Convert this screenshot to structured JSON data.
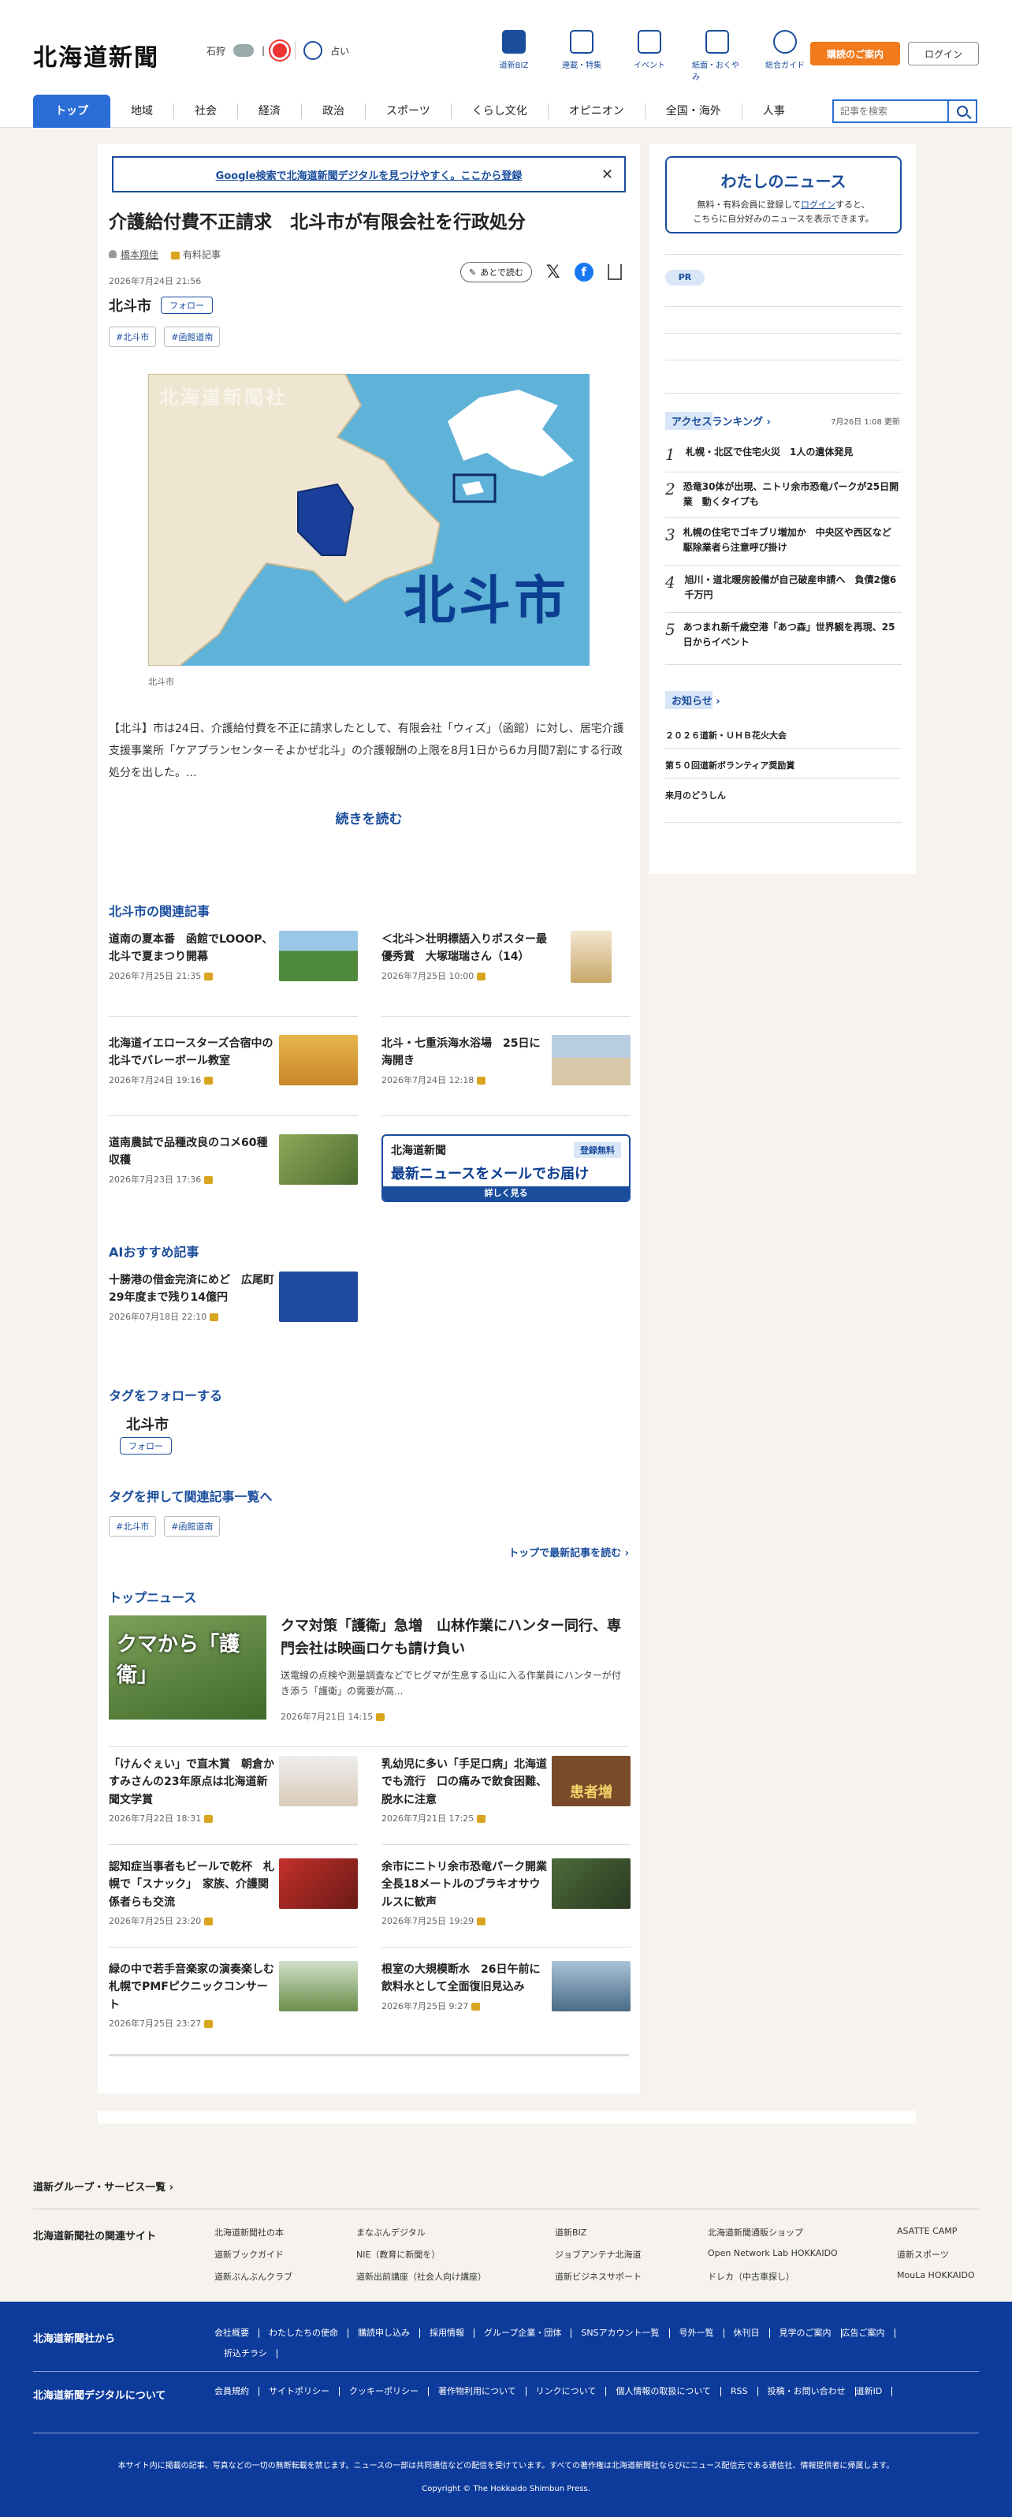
{
  "header": {
    "logo": "北海道新聞",
    "weather_city": "石狩",
    "fortune_label": "占い",
    "nav": [
      "道新BIZ",
      "連載・特集",
      "イベント",
      "紙面・おくやみ",
      "総合ガイド"
    ],
    "subscribe": "購読のご案内",
    "login": "ログイン",
    "search_placeholder": "記事を検索"
  },
  "main_nav": [
    "トップ",
    "地域",
    "社会",
    "経済",
    "政治",
    "スポーツ",
    "くらし文化",
    "オピニオン",
    "全国・海外",
    "人事"
  ],
  "promo": "Google検索で北海道新聞デジタルを見つけやすく。ここから登録",
  "article": {
    "title": "介護給付費不正請求　北斗市が有限会社を行政処分",
    "author": "橋本翔佳",
    "paid_label": "有料記事",
    "date": "2026年7月24日 21:56",
    "later_label": "あとで読む",
    "tag_name": "北斗市",
    "follow": "フォロー",
    "hashtags": [
      "#北斗市",
      "#函館道南"
    ],
    "map_watermark": "北海道新聞社",
    "map_label": "北斗市",
    "map_caption": "北斗市",
    "lead": "【北斗】市は24日、介護給付費を不正に請求したとして、有限会社「ウィズ」（函館）に対し、居宅介護支援事業所「ケアプランセンターそよかぜ北斗」の介護報酬の上限を8月1日から6カ月間7割にする行政処分を出した。...",
    "read_more": "続きを読む"
  },
  "related": {
    "heading": "北斗市の関連記事",
    "items": [
      {
        "title": "道南の夏本番　函館でLOOOP、北斗で夏まつり開幕",
        "date": "2026年7月25日 21:35"
      },
      {
        "title": "＜北斗＞壮明標語入りポスター最優秀賞　大塚瑞瑞さん（14）",
        "date": "2026年7月25日 10:00"
      },
      {
        "title": "北海道イエロースターズ合宿中の北斗でバレーボール教室",
        "date": "2026年7月24日 19:16"
      },
      {
        "title": "北斗・七重浜海水浴場　25日に海開き",
        "date": "2026年7月24日 12:18"
      },
      {
        "title": "道南農試で品種改良のコメ60種収穫",
        "date": "2026年7月23日 17:36"
      }
    ]
  },
  "mail_banner": {
    "brand": "北海道新聞",
    "badge": "登録無料",
    "headline": "最新ニュースをメールでお届け",
    "more": "詳しく見る"
  },
  "ai": {
    "heading": "AIおすすめ記事",
    "item": {
      "title": "十勝港の借金完済にめど　広尾町　29年度まで残り14億円",
      "date": "2026年07月18日 22:10"
    }
  },
  "tag_follow": {
    "heading": "タグをフォローする",
    "name": "北斗市",
    "button": "フォロー"
  },
  "tag_push": {
    "heading": "タグを押して関連記事一覧へ",
    "tags": [
      "#北斗市",
      "#函館道南"
    ],
    "more": "トップで最新記事を読む"
  },
  "top_news": {
    "heading": "トップニュース",
    "hero": {
      "image_caption": "クマから「護衛」",
      "title": "クマ対策「護衛」急増　山林作業にハンター同行、専門会社は映画ロケも請け負い",
      "lead": "送電線の点検や測量調査などでヒグマが生息する山に入る作業員にハンターが付き添う「護衛」の需要が高...",
      "date": "2026年7月21日 14:15"
    },
    "items": [
      {
        "title": "「けんぐぇい」で直木賞　朝倉かすみさんの23年原点は北海道新聞文学賞",
        "date": "2026年7月22日 18:31"
      },
      {
        "title": "乳幼児に多い「手足口病」北海道でも流行　口の痛みで飲食困難、脱水に注意",
        "date": "2026年7月21日 17:25"
      },
      {
        "title": "認知症当事者もビールで乾杯　札幌で「スナック」　家族、介護関係者らも交流",
        "date": "2026年7月25日 23:20"
      },
      {
        "title": "余市にニトリ余市恐竜パーク開業　全長18メートルのブラキオサウルスに歓声",
        "date": "2026年7月25日 19:29"
      },
      {
        "title": "緑の中で若手音楽家の演奏楽しむ　札幌でPMFピクニックコンサート",
        "date": "2026年7月25日 23:27"
      },
      {
        "title": "根室の大規模断水　26日午前に飲料水として全面復旧見込み",
        "date": "2026年7月25日 9:27"
      }
    ],
    "badge_text": "患者増"
  },
  "sidebar": {
    "my_news_title": "わたしのニュース",
    "my_news_body_1": "無料・有料会員に登録して",
    "my_news_login": "ログイン",
    "my_news_body_2": "すると、",
    "my_news_body_3": "こちらに自分好みのニュースを表示できます。",
    "pr": "PR",
    "ranking_heading": "アクセスランキング",
    "ranking_updated": "7月26日 1:08 更新",
    "ranking": [
      {
        "n": "1",
        "title": "札幌・北区で住宅火災　1人の遺体発見"
      },
      {
        "n": "2",
        "title": "恐竜30体が出現、ニトリ余市恐竜パークが25日開業　動くタイプも"
      },
      {
        "n": "3",
        "title": "札幌の住宅でゴキブリ増加か　中央区や西区など　駆除業者ら注意呼び掛け"
      },
      {
        "n": "4",
        "title": "旭川・道北暖房設備が自己破産申請へ　負債2億6千万円"
      },
      {
        "n": "5",
        "title": "あつまれ新千歳空港「あつ森」世界観を再現、25日からイベント"
      }
    ],
    "notice_heading": "お知らせ",
    "notices": [
      "２０２６道新・ＵＨＢ花火大会",
      "第５０回道新ボランティア奨励賞",
      "来月のどうしん"
    ]
  },
  "footer": {
    "group_link": "道新グループ・サービス一覧",
    "related_label": "北海道新聞社の関連サイト",
    "related_sites": [
      "北海道新聞社の本",
      "まなぶんデジタル",
      "道新BIZ",
      "北海道新聞通販ショップ",
      "ASATTE CAMP",
      "道新ブックガイド",
      "NIE（教育に新聞を）",
      "ジョブアンテナ北海道",
      "Open Network Lab HOKKAIDO",
      "道新スポーツ",
      "道新ぶんぶんクラブ",
      "道新出前講座（社会人向け講座）",
      "道新ビジネスサポート",
      "ドレカ（中古車探し）",
      "MouLa HOKKAIDO"
    ],
    "company_label": "北海道新聞社から",
    "company_links": [
      "会社概要",
      "わたしたちの使命",
      "購読申し込み",
      "採用情報",
      "グループ企業・団体",
      "SNSアカウント一覧",
      "号外一覧",
      "休刊日",
      "見学のご案内",
      "広告ご案内",
      "折込チラシ"
    ],
    "digital_label": "北海道新聞デジタルについて",
    "digital_links": [
      "会員規約",
      "サイトポリシー",
      "クッキーポリシー",
      "著作物利用について",
      "リンクについて",
      "個人情報の取扱について",
      "RSS",
      "投稿・お問い合わせ",
      "道新ID"
    ],
    "notice": "本サイト内に掲載の記事、写真などの一切の無断転載を禁じます。ニュースの一部は共同通信などの配信を受けています。すべての著作権は北海道新聞社ならびにニュース配信元である通信社、情報提供者に帰属します。",
    "copyright": "Copyright © The Hokkaido Shimbun Press."
  }
}
